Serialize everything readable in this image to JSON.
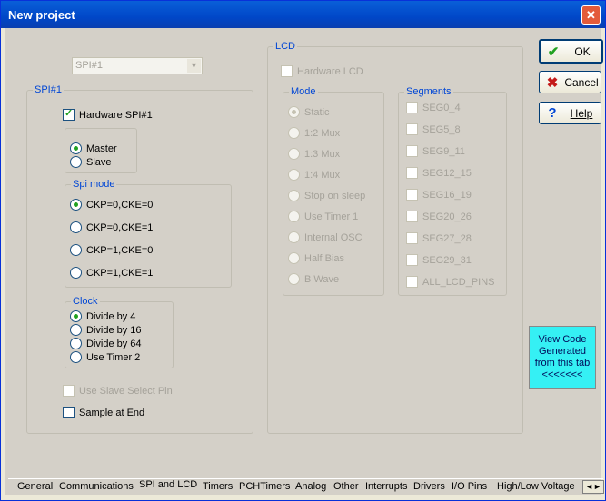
{
  "window": {
    "title": "New project",
    "close_label": "✕"
  },
  "spi_device_combo": {
    "value": "SPI#1"
  },
  "spi": {
    "group_label": "SPI#1",
    "hardware_spi": "Hardware SPI#1",
    "role": {
      "master": "Master",
      "slave": "Slave",
      "selected": "Master"
    },
    "spi_mode": {
      "label": "Spi mode",
      "options": [
        "CKP=0,CKE=0",
        "CKP=0,CKE=1",
        "CKP=1,CKE=0",
        "CKP=1,CKE=1"
      ],
      "selected": "CKP=0,CKE=0"
    },
    "clock": {
      "label": "Clock",
      "options": [
        "Divide by 4",
        "Divide by 16",
        "Divide by 64",
        "Use Timer 2"
      ],
      "selected": "Divide by 4"
    },
    "use_slave_select_pin": "Use Slave Select Pin",
    "sample_at_end": "Sample at End"
  },
  "lcd": {
    "group_label": "LCD",
    "hardware_lcd": "Hardware LCD",
    "mode": {
      "label": "Mode",
      "options": [
        "Static",
        "1:2 Mux",
        "1:3 Mux",
        "1:4 Mux",
        "Stop on sleep",
        "Use Timer 1",
        "Internal OSC",
        "Half Bias",
        "B Wave"
      ],
      "selected": "Static"
    },
    "segments": {
      "label": "Segments",
      "items": [
        "SEG0_4",
        "SEG5_8",
        "SEG9_11",
        "SEG12_15",
        "SEG16_19",
        "SEG20_26",
        "SEG27_28",
        "SEG29_31",
        "ALL_LCD_PINS"
      ]
    }
  },
  "buttons": {
    "ok": "OK",
    "cancel": "Cancel",
    "help": "Help"
  },
  "view_code": {
    "line1": "View Code",
    "line2": "Generated",
    "line3": "from this tab",
    "line4": "<<<<<<<"
  },
  "tabs": [
    "General",
    "Communications",
    "SPI and LCD",
    "Timers",
    "PCHTimers",
    "Analog",
    "Other",
    "Interrupts",
    "Drivers",
    "I/O Pins",
    "High/Low Voltage"
  ],
  "active_tab": "SPI and LCD",
  "colors": {
    "title_bar": "#0047c8",
    "group_label": "#0046d5",
    "check_green": "#21a121",
    "view_code_bg": "#35f0f4"
  }
}
